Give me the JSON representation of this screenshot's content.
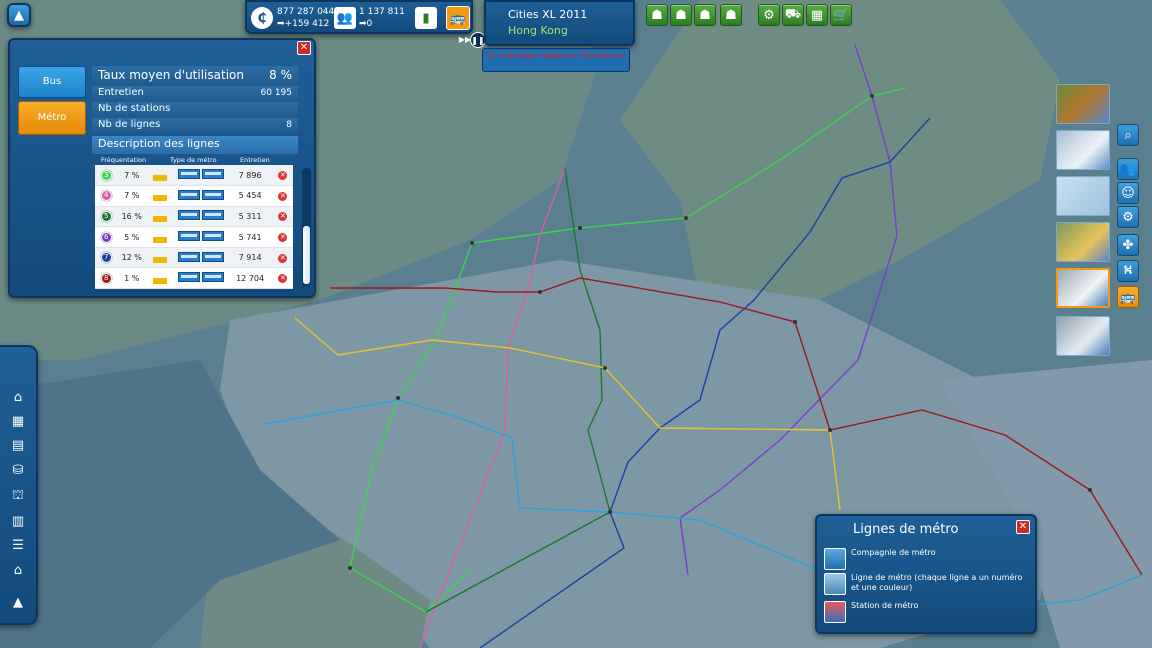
{
  "topbar": {
    "money": "877 287 044",
    "money_delta": "+159 412",
    "population": "1 137 811",
    "population_delta": "0",
    "city_game": "Cities XL 2011",
    "city_name": "Hong Kong",
    "notification": "Le chômage frappe les Travailleurs"
  },
  "transport_panel": {
    "tabs": [
      "Bus",
      "Métro"
    ],
    "active_tab": "Métro",
    "usage_label": "Taux moyen d'utilisation",
    "usage_value": "8 %",
    "maintenance_label": "Entretien",
    "maintenance_value": "60 195",
    "stations_label": "Nb de stations",
    "lines_label": "Nb de lignes",
    "lines_value": "8",
    "description_title": "Description des lignes",
    "col_frequentation": "Fréquentation",
    "col_type": "Type de métro",
    "col_entretien": "Entretien",
    "lines": [
      {
        "num": "3",
        "color": "#37d64b",
        "freq": "7 %",
        "cost": "7 896"
      },
      {
        "num": "4",
        "color": "#e05aa6",
        "freq": "7 %",
        "cost": "5 454"
      },
      {
        "num": "5",
        "color": "#1a7a2a",
        "freq": "16 %",
        "cost": "5 311"
      },
      {
        "num": "6",
        "color": "#7b3bcf",
        "freq": "5 %",
        "cost": "5 741"
      },
      {
        "num": "7",
        "color": "#1b3fa8",
        "freq": "12 %",
        "cost": "7 914"
      },
      {
        "num": "8",
        "color": "#9c1a1a",
        "freq": "1 %",
        "cost": "12 704"
      }
    ]
  },
  "legend": {
    "title": "Lignes de métro",
    "items": [
      {
        "icon": "metro-company-icon",
        "label": "Compagnie de métro"
      },
      {
        "icon": "metro-line-icon",
        "label": "Ligne de métro (chaque ligne a un numéro et une couleur)"
      },
      {
        "icon": "metro-station-icon",
        "label": "Station de métro"
      }
    ]
  },
  "colors": {
    "panel": "#1a5487",
    "active_tab": "#f39a12",
    "tab": "#1e8fd6",
    "close": "#c92a2a",
    "metro_lines": [
      "#37d64b",
      "#e05aa6",
      "#1a7a2a",
      "#7b3bcf",
      "#1b3fa8",
      "#9c1a1a",
      "#e9c22d",
      "#2aa2dc"
    ]
  },
  "icons": {
    "pause": "pause-icon",
    "bus": "bus-icon",
    "cart": "cart-icon"
  }
}
